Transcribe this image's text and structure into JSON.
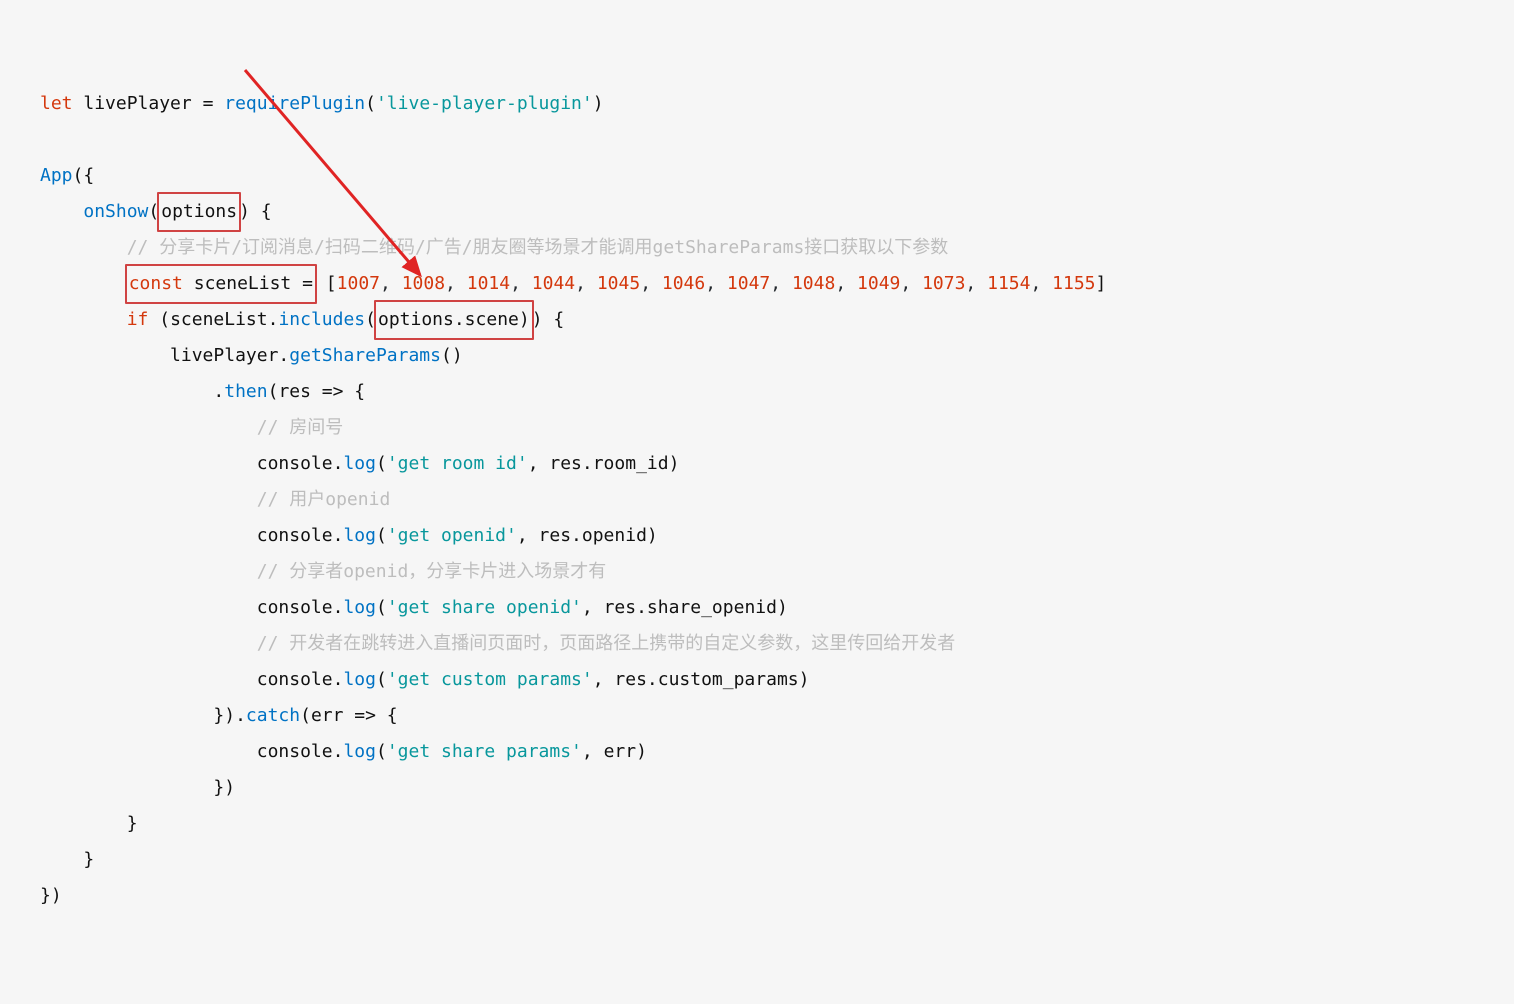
{
  "code": {
    "l1_let": "let",
    "l1_livePlayer": " livePlayer ",
    "l1_eq": "=",
    "l1_require": " requirePlugin",
    "l1_paren_o": "(",
    "l1_str": "'live-player-plugin'",
    "l1_paren_c": ")",
    "l3_App": "App",
    "l3_rest": "({",
    "l4_pad": "    ",
    "l4_onShow": "onShow",
    "l4_paren_o": "(",
    "l4_options": "options",
    "l4_rest": ") {",
    "l5_pad": "        ",
    "l5_cmt": "// 分享卡片/订阅消息/扫码二维码/广告/朋友圈等场景才能调用getShareParams接口获取以下参数",
    "l6_pad": "        ",
    "l6_const": "const",
    "l6_sceneList": " sceneList ",
    "l6_eq": "=",
    "l6_sp": " ",
    "l6_b_o": "[",
    "l6_n1": "1007",
    "l6_c1": ", ",
    "l6_n2": "1008",
    "l6_c2": ", ",
    "l6_n3": "1014",
    "l6_c3": ", ",
    "l6_n4": "1044",
    "l6_c4": ", ",
    "l6_n5": "1045",
    "l6_c5": ", ",
    "l6_n6": "1046",
    "l6_c6": ", ",
    "l6_n7": "1047",
    "l6_c7": ", ",
    "l6_n8": "1048",
    "l6_c8": ", ",
    "l6_n9": "1049",
    "l6_c9": ", ",
    "l6_n10": "1073",
    "l6_c10": ", ",
    "l6_n11": "1154",
    "l6_c11": ", ",
    "l6_n12": "1155",
    "l6_b_c": "]",
    "l7_pad": "        ",
    "l7_if": "if",
    "l7_sp": " (sceneList.",
    "l7_includes": "includes",
    "l7_paren_o": "(",
    "l7_opts_scene": "options.scene)",
    "l7_rest": ") {",
    "l8_pad": "            ",
    "l8_text1": "livePlayer.",
    "l8_getShareParams": "getShareParams",
    "l8_rest": "()",
    "l9_pad": "                ",
    "l9_dot": ".",
    "l9_then": "then",
    "l9_rest1": "(",
    "l9_res": "res",
    "l9_rest2": " => {",
    "l10_pad": "                    ",
    "l10_cmt": "// 房间号",
    "l11_pad": "                    ",
    "l11_console": "console.",
    "l11_log": "log",
    "l11_paren_o": "(",
    "l11_str": "'get room id'",
    "l11_rest": ", res.room_id)",
    "l12_pad": "                    ",
    "l12_cmt": "// 用户openid",
    "l13_pad": "                    ",
    "l13_console": "console.",
    "l13_log": "log",
    "l13_paren_o": "(",
    "l13_str": "'get openid'",
    "l13_rest": ", res.openid)",
    "l14_pad": "                    ",
    "l14_cmt": "// 分享者openid，分享卡片进入场景才有",
    "l15_pad": "                    ",
    "l15_console": "console.",
    "l15_log": "log",
    "l15_paren_o": "(",
    "l15_str": "'get share openid'",
    "l15_rest": ", res.share_openid)",
    "l16_pad": "                    ",
    "l16_cmt": "// 开发者在跳转进入直播间页面时，页面路径上携带的自定义参数，这里传回给开发者",
    "l17_pad": "                    ",
    "l17_console": "console.",
    "l17_log": "log",
    "l17_paren_o": "(",
    "l17_str": "'get custom params'",
    "l17_rest": ", res.custom_params)",
    "l18_pad": "                ",
    "l18_close": "}).",
    "l18_catch": "catch",
    "l18_rest1": "(",
    "l18_err": "err",
    "l18_rest2": " => {",
    "l19_pad": "                    ",
    "l19_console": "console.",
    "l19_log": "log",
    "l19_paren_o": "(",
    "l19_str": "'get share params'",
    "l19_rest": ", err)",
    "l20_pad": "                ",
    "l20_text": "})",
    "l21_pad": "        ",
    "l21_text": "}",
    "l22_pad": "    ",
    "l22_text": "}",
    "l23_text": "})"
  },
  "annotations": {
    "box1_label": "options-parameter-highlight",
    "box2_label": "const-sceneList-highlight",
    "box3_label": "options-scene-highlight",
    "arrow_label": "arrow-from-options-to-options-scene"
  }
}
